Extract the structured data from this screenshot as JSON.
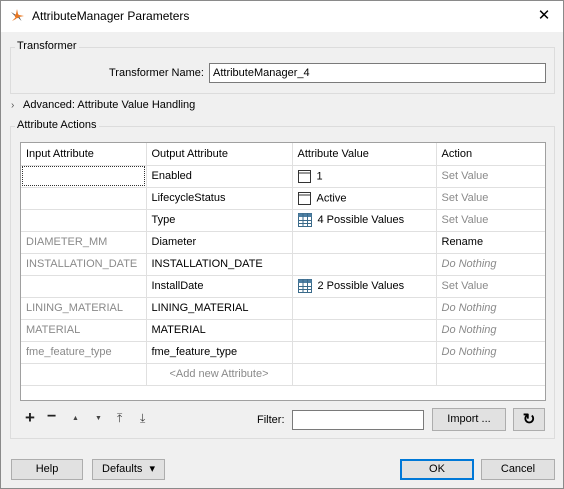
{
  "window": {
    "title": "AttributeManager Parameters",
    "close_glyph": "✕"
  },
  "transformer": {
    "group_label": "Transformer",
    "name_label": "Transformer Name:",
    "name_value": "AttributeManager_4"
  },
  "advanced": {
    "label": "Advanced: Attribute Value Handling"
  },
  "actions": {
    "group_label": "Attribute Actions",
    "columns": [
      "Input Attribute",
      "Output Attribute",
      "Attribute Value",
      "Action"
    ],
    "rows": [
      {
        "input": "",
        "output": "Enabled",
        "value": "1",
        "value_icon": "text-icon",
        "action": "Set Value"
      },
      {
        "input": "",
        "output": "LifecycleStatus",
        "value": "Active",
        "value_icon": "text-icon",
        "action": "Set Value"
      },
      {
        "input": "",
        "output": "Type",
        "value": "4 Possible Values",
        "value_icon": "table-icon",
        "action": "Set Value"
      },
      {
        "input": "DIAMETER_MM",
        "output": "Diameter",
        "value": "",
        "value_icon": "",
        "action": "Rename"
      },
      {
        "input": "INSTALLATION_DATE",
        "output": "INSTALLATION_DATE",
        "value": "",
        "value_icon": "",
        "action": "Do Nothing"
      },
      {
        "input": "",
        "output": "InstallDate",
        "value": "2 Possible Values",
        "value_icon": "table-icon",
        "action": "Set Value"
      },
      {
        "input": "LINING_MATERIAL",
        "output": "LINING_MATERIAL",
        "value": "",
        "value_icon": "",
        "action": "Do Nothing"
      },
      {
        "input": "MATERIAL",
        "output": "MATERIAL",
        "value": "",
        "value_icon": "",
        "action": "Do Nothing"
      },
      {
        "input": "fme_feature_type",
        "output": "fme_feature_type",
        "value": "",
        "value_icon": "",
        "action": "Do Nothing"
      }
    ],
    "add_row_label": "<Add new Attribute>"
  },
  "toolbar": {
    "add_glyph": "+",
    "remove_glyph": "−",
    "up_glyph": "▲",
    "down_glyph": "▼",
    "top_glyph": "⤒",
    "bottom_glyph": "⤓",
    "filter_label": "Filter:",
    "filter_value": "",
    "import_label": "Import ...",
    "refresh_glyph": "↻"
  },
  "footer": {
    "help_label": "Help",
    "defaults_label": "Defaults",
    "defaults_arrow": "▾",
    "ok_label": "OK",
    "cancel_label": "Cancel"
  },
  "colors": {
    "primary_border": "#0078d7",
    "muted_text": "#8a8a8a"
  }
}
